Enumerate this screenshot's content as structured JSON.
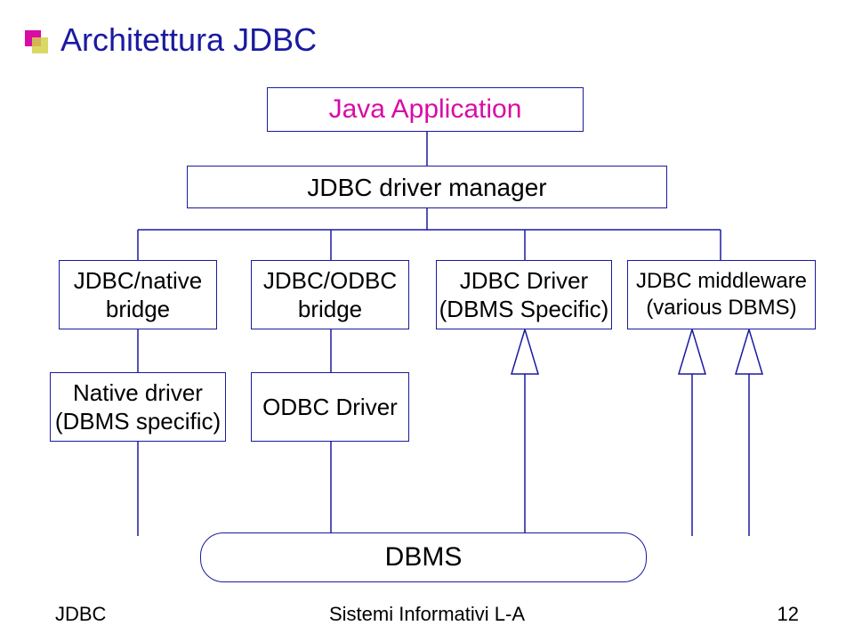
{
  "title": "Architettura JDBC",
  "boxes": {
    "java_app": "Java Application",
    "driver_manager": "JDBC driver manager",
    "jdbc_native": "JDBC/native\nbridge",
    "jdbc_odbc": "JDBC/ODBC\nbridge",
    "jdbc_driver": "JDBC Driver\n(DBMS Specific)",
    "jdbc_middleware": "JDBC middleware\n(various DBMS)",
    "native_driver": "Native driver\n(DBMS specific)",
    "odbc_driver": "ODBC Driver",
    "dbms": "DBMS"
  },
  "footer": {
    "left": "JDBC",
    "center": "Sistemi Informativi L-A",
    "right": "12"
  }
}
